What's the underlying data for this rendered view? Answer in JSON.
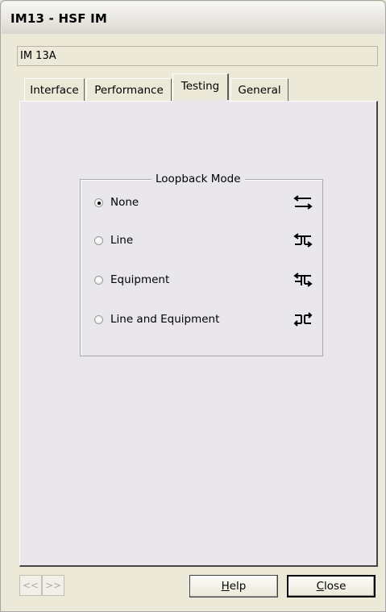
{
  "window": {
    "title": "IM13 - HSF IM"
  },
  "name_field": {
    "value": "IM 13A"
  },
  "tabs": [
    {
      "label": "Interface",
      "active": false
    },
    {
      "label": "Performance",
      "active": false
    },
    {
      "label": "Testing",
      "active": true
    },
    {
      "label": "General",
      "active": false
    }
  ],
  "loopback": {
    "title": "Loopback Mode",
    "selected": "None",
    "options": [
      {
        "label": "None",
        "icon": "loopback-none-icon",
        "checked": true
      },
      {
        "label": "Line",
        "icon": "loopback-line-icon",
        "checked": false
      },
      {
        "label": "Equipment",
        "icon": "loopback-equipment-icon",
        "checked": false
      },
      {
        "label": "Line and Equipment",
        "icon": "loopback-line-and-equipment-icon",
        "checked": false
      }
    ]
  },
  "buttons": {
    "prev_label": "<<",
    "next_label": ">>",
    "help_mnemonic": "H",
    "help_rest": "elp",
    "close_mnemonic": "C",
    "close_rest": "lose"
  }
}
